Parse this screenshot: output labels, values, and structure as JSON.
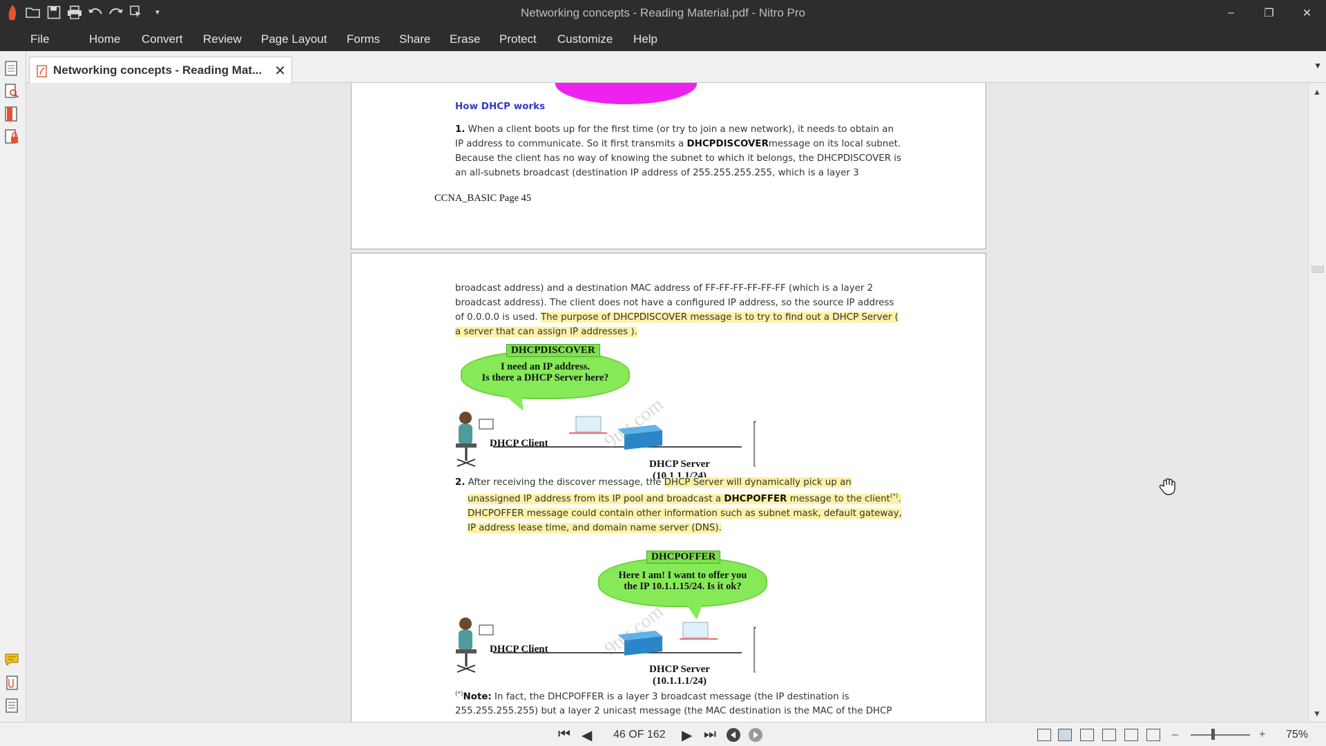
{
  "window": {
    "title": "Networking concepts - Reading Material.pdf - Nitro Pro",
    "minimize": "–",
    "restore": "❐",
    "close": "✕"
  },
  "quick_access": {
    "icons": [
      "nitro-logo-icon",
      "open-folder-icon",
      "save-icon",
      "print-icon",
      "undo-icon",
      "redo-icon",
      "select-tool-icon",
      "customize-qat-icon"
    ]
  },
  "menu": {
    "items": [
      "File",
      "Home",
      "Convert",
      "Review",
      "Page Layout",
      "Forms",
      "Share",
      "Erase",
      "Protect",
      "Customize",
      "Help"
    ]
  },
  "tab": {
    "label": "Networking concepts - Reading Mat...",
    "close": "✕"
  },
  "page1": {
    "heading": "How DHCP works",
    "para_num": "1.",
    "lines": [
      "When a client boots up for the first time (or try to join a new network), it needs to obtain an",
      "IP address to communicate. So it first transmits a ",
      "DHCPDISCOVER",
      "message on its local subnet.",
      "Because the client has no way of knowing the subnet to which it belongs, the DHCPDISCOVER is",
      "an all-subnets broadcast (destination IP address of 255.255.255.255, which is a layer 3"
    ],
    "footer": "CCNA_BASIC Page 45"
  },
  "page2": {
    "p1": [
      "broadcast address) and a destination MAC address of FF-FF-FF-FF-FF-FF (which is a layer 2",
      "broadcast address). The client does not have a configured IP address, so the source IP address",
      "of 0.0.0.0 is used. ",
      "The purpose of DHCPDISCOVER message is to try to find out a DHCP Server (",
      "a server that can assign IP addresses )."
    ],
    "fig1": {
      "tag": "DHCPDISCOVER",
      "bubble_line1": "I need an IP address.",
      "bubble_line2": "Is there a DHCP Server here?",
      "client": "DHCP Client",
      "server": "DHCP Server",
      "server_ip": "(10.1.1.1/24)",
      "watermark": "9tut.com"
    },
    "p2": {
      "num": "2.",
      "l1a": "After receiving the discover message, the ",
      "l1b": "DHCP Server will dynamically pick up an",
      "l2a": "unassigned IP address from its IP pool and broadcast a ",
      "l2b": "DHCPOFFER",
      "l2c": " message to the client",
      "l2sup": "(*)",
      "l2d": ".",
      "l3": "DHCPOFFER message could contain other information such as subnet mask, default gateway,",
      "l4": "IP address lease time, and domain name server (DNS)."
    },
    "fig2": {
      "tag": "DHCPOFFER",
      "bubble_line1": "Here I am! I want to offer you",
      "bubble_line2": "the IP 10.1.1.15/24. Is it ok?",
      "client": "DHCP Client",
      "server": "DHCP Server",
      "server_ip": "(10.1.1.1/24)",
      "watermark": "9tut.com"
    },
    "note": {
      "sup": "(*)",
      "label": "Note:",
      "l1": " In fact, the DHCPOFFER is a layer 3 broadcast message (the IP destination is",
      "l2": "255.255.255.255) but a layer 2 unicast message (the MAC destination is the MAC of the DHCP"
    }
  },
  "status": {
    "page_indicator": "46 OF 162",
    "zoom": "75%",
    "zoom_out": "–",
    "zoom_in": "+"
  },
  "colors": {
    "chrome_dark": "#2d2d2d",
    "heading_blue": "#2f3ac7",
    "highlight": "#fdf1a3",
    "bubble_green": "#86ea58"
  }
}
